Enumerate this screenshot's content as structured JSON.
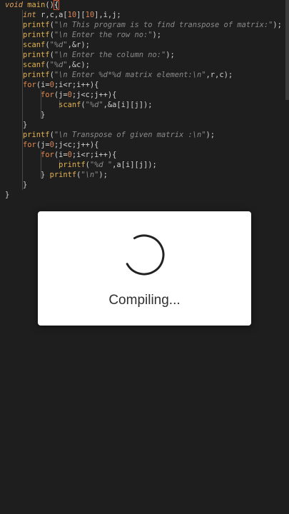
{
  "code": {
    "lines": [
      [
        [
          "void",
          "type"
        ],
        [
          " ",
          "plain"
        ],
        [
          "main",
          "fn"
        ],
        [
          "()",
          "plain"
        ],
        [
          "{",
          "brace-hl"
        ]
      ],
      [
        [
          "    ",
          "plain"
        ],
        [
          "int",
          "type"
        ],
        [
          " r,c,a[",
          "plain"
        ],
        [
          "10",
          "num"
        ],
        [
          "][",
          "plain"
        ],
        [
          "10",
          "num"
        ],
        [
          "],i,j;",
          "plain"
        ]
      ],
      [
        [
          "    ",
          "plain"
        ],
        [
          "printf",
          "fn"
        ],
        [
          "(",
          "plain"
        ],
        [
          "\"\\n This program is to find transpose of matrix:\"",
          "str"
        ],
        [
          ");",
          "plain"
        ]
      ],
      [
        [
          "    ",
          "plain"
        ],
        [
          "printf",
          "fn"
        ],
        [
          "(",
          "plain"
        ],
        [
          "\"\\n Enter the row no:\"",
          "str"
        ],
        [
          ");",
          "plain"
        ]
      ],
      [
        [
          "    ",
          "plain"
        ],
        [
          "scanf",
          "fn"
        ],
        [
          "(",
          "plain"
        ],
        [
          "\"%d\"",
          "str"
        ],
        [
          ",&r);",
          "plain"
        ]
      ],
      [
        [
          "    ",
          "plain"
        ],
        [
          "printf",
          "fn"
        ],
        [
          "(",
          "plain"
        ],
        [
          "\"\\n Enter the column no:\"",
          "str"
        ],
        [
          ");",
          "plain"
        ]
      ],
      [
        [
          "    ",
          "plain"
        ],
        [
          "scanf",
          "fn"
        ],
        [
          "(",
          "plain"
        ],
        [
          "\"%d\"",
          "str"
        ],
        [
          ",&c);",
          "plain"
        ]
      ],
      [
        [
          "    ",
          "plain"
        ],
        [
          "printf",
          "fn"
        ],
        [
          "(",
          "plain"
        ],
        [
          "\"\\n Enter %d*%d matrix element:\\n\"",
          "str"
        ],
        [
          ",r,c);",
          "plain"
        ]
      ],
      [
        [
          "    ",
          "plain"
        ],
        [
          "for",
          "key"
        ],
        [
          "(i=",
          "plain"
        ],
        [
          "0",
          "num"
        ],
        [
          ";i<r;i++){",
          "plain"
        ]
      ],
      [
        [
          "        ",
          "plain"
        ],
        [
          "for",
          "key"
        ],
        [
          "(j=",
          "plain"
        ],
        [
          "0",
          "num"
        ],
        [
          ";j<c;j++){",
          "plain"
        ]
      ],
      [
        [
          "            ",
          "plain"
        ],
        [
          "scanf",
          "fn"
        ],
        [
          "(",
          "plain"
        ],
        [
          "\"%d\"",
          "str"
        ],
        [
          ",&a[i][j]);",
          "plain"
        ]
      ],
      [
        [
          "        ",
          "plain"
        ],
        [
          "}",
          "brace"
        ]
      ],
      [
        [
          "    ",
          "plain"
        ],
        [
          "}",
          "brace"
        ]
      ],
      [
        [
          "    ",
          "plain"
        ],
        [
          "printf",
          "fn"
        ],
        [
          "(",
          "plain"
        ],
        [
          "\"\\n Transpose of given matrix :\\n\"",
          "str"
        ],
        [
          ");",
          "plain"
        ]
      ],
      [
        [
          "    ",
          "plain"
        ],
        [
          "for",
          "key"
        ],
        [
          "(j=",
          "plain"
        ],
        [
          "0",
          "num"
        ],
        [
          ";j<c;j++){",
          "plain"
        ]
      ],
      [
        [
          "        ",
          "plain"
        ],
        [
          "for",
          "key"
        ],
        [
          "(i=",
          "plain"
        ],
        [
          "0",
          "num"
        ],
        [
          ";i<r;i++){",
          "plain"
        ]
      ],
      [
        [
          "            ",
          "plain"
        ],
        [
          "printf",
          "fn"
        ],
        [
          "(",
          "plain"
        ],
        [
          "\"%d \"",
          "str"
        ],
        [
          ",a[i][j]);",
          "plain"
        ]
      ],
      [
        [
          "        ",
          "plain"
        ],
        [
          "} ",
          "brace"
        ],
        [
          "printf",
          "fn"
        ],
        [
          "(",
          "plain"
        ],
        [
          "\"\\n\"",
          "str"
        ],
        [
          ");",
          "plain"
        ]
      ],
      [
        [
          "    ",
          "plain"
        ],
        [
          "}",
          "brace"
        ]
      ],
      [
        [
          "}",
          "brace"
        ]
      ]
    ]
  },
  "dialog": {
    "message": "Compiling...",
    "spinner_icon": "loading-spinner-icon"
  },
  "colors": {
    "background": "#1e1e1e",
    "dialog_bg": "#ffffff",
    "spinner": "#222222"
  }
}
